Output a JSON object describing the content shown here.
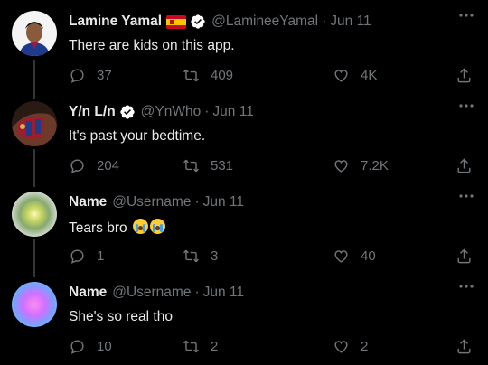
{
  "tweets": [
    {
      "name": "Lamine Yamal",
      "handle": "@LamineeYamal",
      "date": "Jun 11",
      "flag": true,
      "verified": true,
      "text": "There are kids on this app.",
      "replies": "37",
      "retweets": "409",
      "likes": "4K"
    },
    {
      "name": "Y/n L/n",
      "handle": "@YnWho",
      "date": "Jun 11",
      "verified": true,
      "text": "It's past your bedtime.",
      "replies": "204",
      "retweets": "531",
      "likes": "7.2K"
    },
    {
      "name": "Name",
      "handle": "@Username",
      "date": "Jun 11",
      "text": "Tears bro",
      "emoji": "loudly-crying-face",
      "replies": "1",
      "retweets": "3",
      "likes": "40"
    },
    {
      "name": "Name",
      "handle": "@Username",
      "date": "Jun 11",
      "text": "She's so real tho",
      "replies": "10",
      "retweets": "2",
      "likes": "2"
    }
  ],
  "separator": "·",
  "colors": {
    "background": "#000000",
    "text": "#e7e9ea",
    "muted": "#71767b",
    "verified": "#ffffff"
  }
}
